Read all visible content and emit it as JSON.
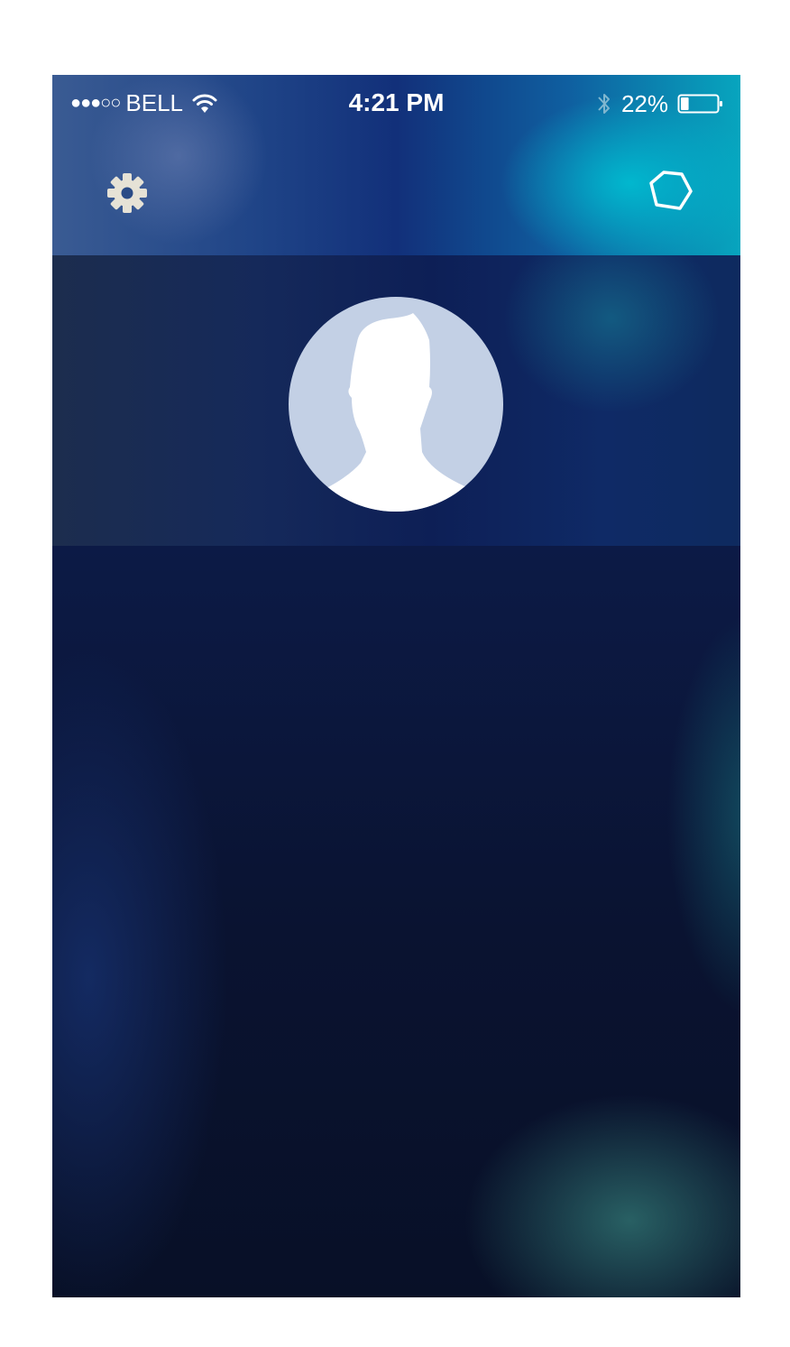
{
  "status_bar": {
    "signal": "●●●○○",
    "carrier": "BELL",
    "time": "4:21 PM",
    "battery_percent": "22%",
    "battery_level": 0.22
  },
  "nav": {
    "settings_icon": "gear-icon",
    "right_icon": "pentagon-icon"
  },
  "profile": {
    "avatar_icon": "default-profile-silhouette"
  },
  "colors": {
    "header_start": "#3a5b93",
    "header_end": "#07a5be",
    "background": "#0a1331",
    "avatar_bg": "#c3d0e5",
    "gear": "#e6e2d6"
  }
}
